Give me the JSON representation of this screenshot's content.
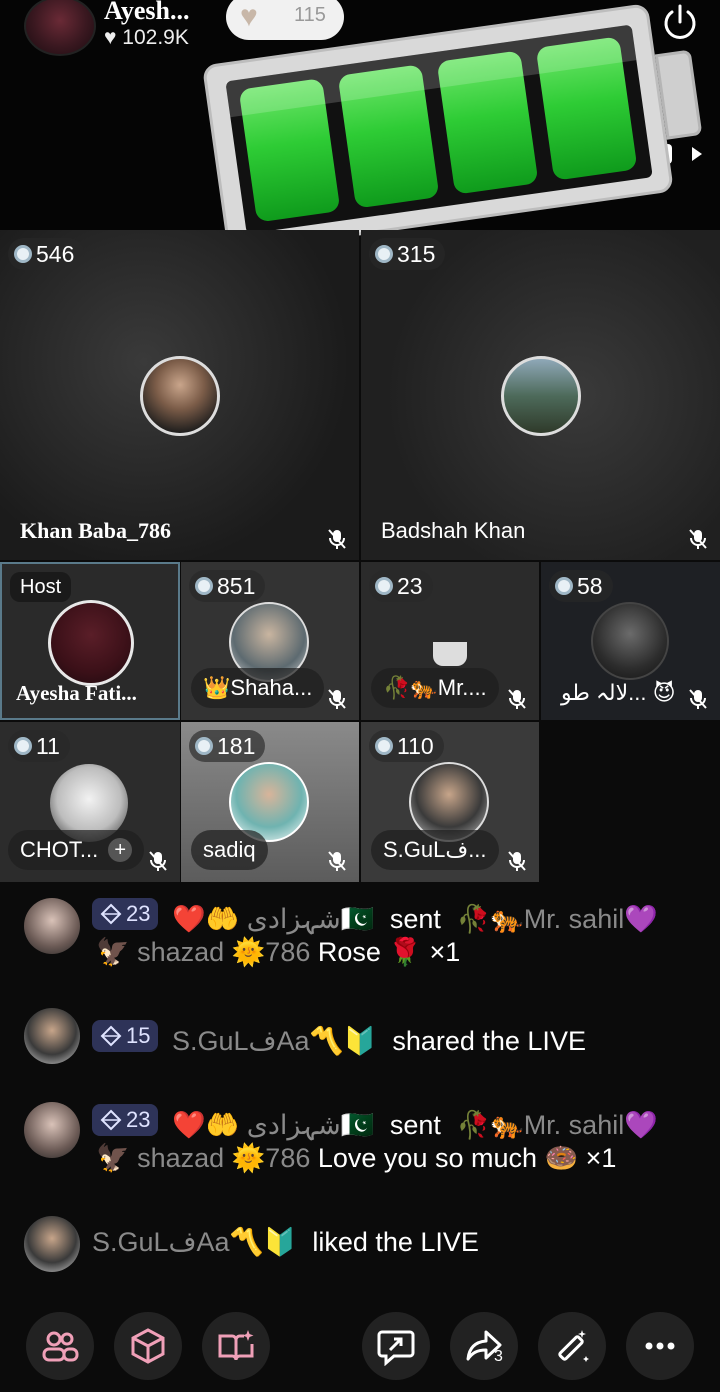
{
  "header": {
    "host_name": "Ayesh...",
    "host_likes": "♥ 102.9K",
    "like_count": "115"
  },
  "tiles": [
    {
      "coins": "546",
      "name": "Khan Baba_786"
    },
    {
      "coins": "315",
      "name": "Badshah Khan"
    },
    {
      "label": "Host",
      "name": "Ayesha Fati..."
    },
    {
      "coins": "851",
      "name": "👑Shaha..."
    },
    {
      "coins": "23",
      "name": "🥀🐅Mr...."
    },
    {
      "coins": "58",
      "name": "لالہ طو... 😈"
    },
    {
      "coins": "11",
      "name": "CHOT...",
      "add": "+"
    },
    {
      "coins": "181",
      "name": "sadiq"
    },
    {
      "coins": "110",
      "name": "S.GuLف..."
    }
  ],
  "chat": [
    {
      "level": "23",
      "user": "❤️🤲 شہزادی🇵🇰",
      "action": "sent",
      "target": "🥀🐅Mr. sahil💜",
      "line2_user": "🦅 shazad 🌞786",
      "line2_text": "Rose 🌹 ×1"
    },
    {
      "level": "15",
      "user": "S.GuLفAa〽️🔰",
      "action": "shared the LIVE"
    },
    {
      "level": "23",
      "user": "❤️🤲 شہزادی🇵🇰",
      "action": "sent",
      "target": "🥀🐅Mr. sahil💜",
      "line2_user": "🦅 shazad 🌞786",
      "line2_text": "Love you so much 🍩 ×1"
    },
    {
      "user": "S.GuLفAa〽️🔰",
      "action": "liked the LIVE"
    }
  ],
  "bottom_bar": {
    "icons": [
      "people-icon",
      "cube-icon",
      "book-sparkle-icon",
      "chat-share-icon",
      "share-arrow-icon",
      "magic-wand-icon",
      "more-icon"
    ],
    "share_count": "3"
  }
}
